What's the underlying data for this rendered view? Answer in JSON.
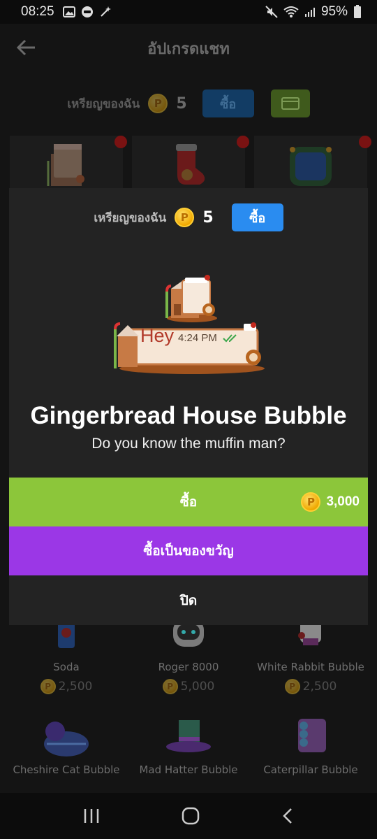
{
  "status_bar": {
    "time": "08:25",
    "battery": "95%",
    "icons": [
      "image-icon",
      "line-app-icon",
      "magic-wand-icon",
      "mute-icon",
      "wifi-icon",
      "signal-icon",
      "battery-icon"
    ]
  },
  "header": {
    "title": "อัปเกรดแชท",
    "back_icon": "arrow-left-icon"
  },
  "wallet": {
    "label": "เหรียญของฉัน",
    "coins": "5",
    "buy_label": "ซื้อ",
    "wallet_icon": "wallet-icon"
  },
  "modal": {
    "coins_label": "เหรียญของฉัน",
    "coins": "5",
    "buy_coins_label": "ซื้อ",
    "preview_text": "Hey",
    "preview_time": "4:24 PM",
    "title": "Gingerbread House Bubble",
    "subtitle": "Do you know the muffin man?",
    "buy_label": "ซื้อ",
    "price": "3,000",
    "gift_label": "ซื้อเป็นของขวัญ",
    "close_label": "ปิด"
  },
  "items_row_1": [
    {
      "name": "Soda",
      "price": "2,500"
    },
    {
      "name": "Roger 8000",
      "price": "5,000"
    },
    {
      "name": "White Rabbit Bubble",
      "price": "2,500"
    }
  ],
  "items_row_2": [
    {
      "name": "Cheshire Cat Bubble"
    },
    {
      "name": "Mad Hatter Bubble"
    },
    {
      "name": "Caterpillar Bubble"
    }
  ],
  "colors": {
    "buy_green": "#8cc63a",
    "gift_purple": "#9b37e6",
    "accent_blue": "#2a8cf0",
    "coin_gold": "#f0a800",
    "badge_red": "#7a1212"
  },
  "nav": [
    "recents-icon",
    "home-icon",
    "back-icon"
  ]
}
